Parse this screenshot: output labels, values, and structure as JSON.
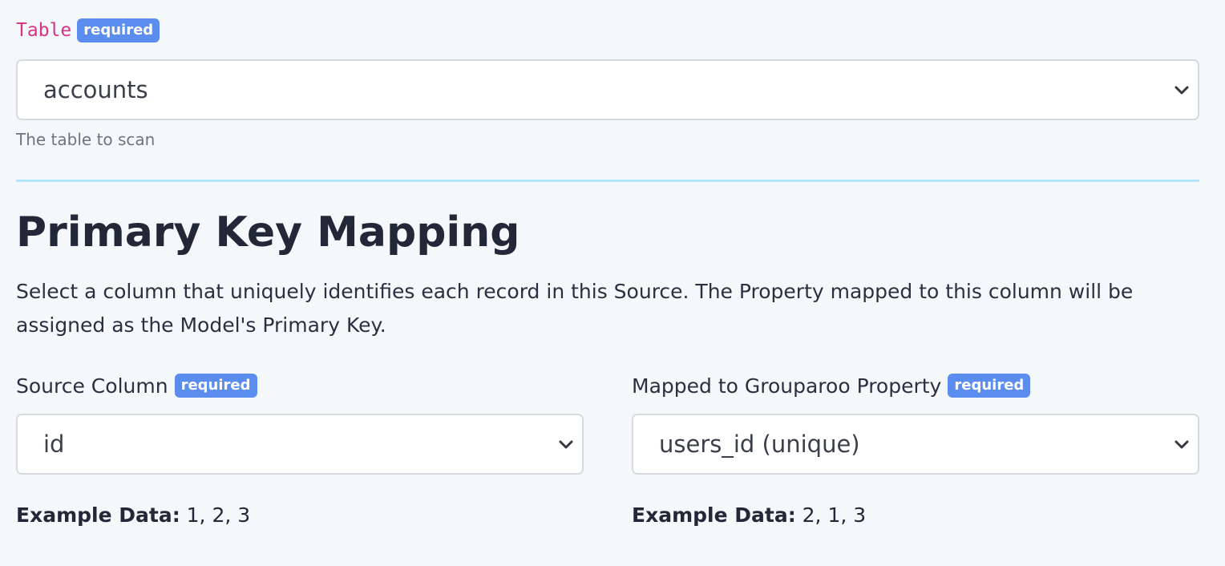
{
  "table_field": {
    "label": "Table",
    "badge": "required",
    "selected": "accounts",
    "help": "The table to scan"
  },
  "section": {
    "title": "Primary Key Mapping",
    "description": "Select a column that uniquely identifies each record in this Source. The Property mapped to this column will be assigned as the Model's Primary Key."
  },
  "source_column": {
    "label": "Source Column",
    "badge": "required",
    "selected": "id",
    "example_label": "Example Data:",
    "example_values": "1, 2, 3"
  },
  "property": {
    "label": "Mapped to Grouparoo Property",
    "badge": "required",
    "selected": "users_id (unique)",
    "example_label": "Example Data:",
    "example_values": "2, 1, 3"
  },
  "colors": {
    "badge": "#5b8def",
    "code_label": "#d63384",
    "divider": "#b3e5fc",
    "background": "#f5f8fa"
  },
  "icons": {
    "select_arrow": "chevron-down-icon"
  }
}
